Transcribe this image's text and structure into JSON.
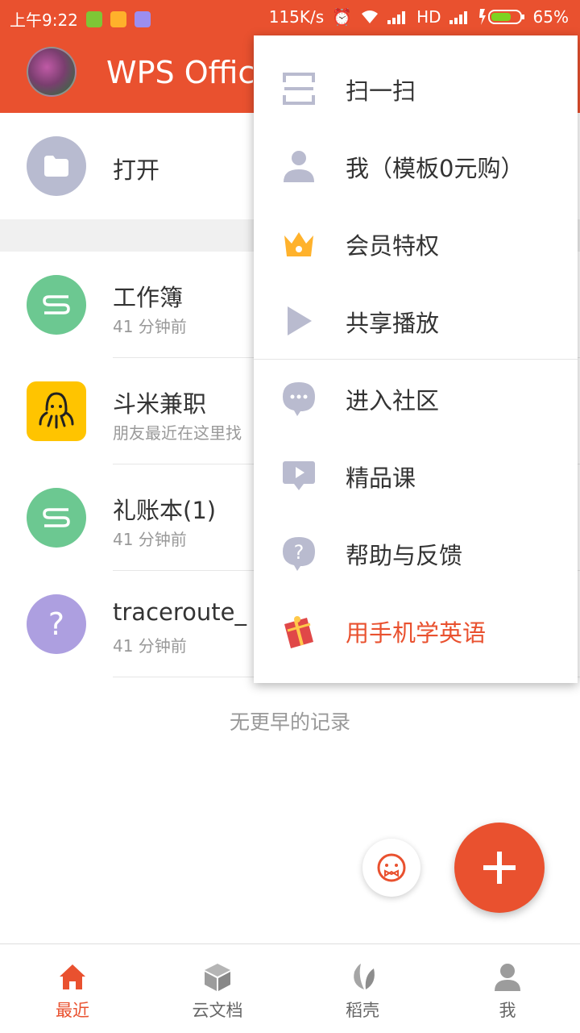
{
  "status_bar": {
    "time": "上午9:22",
    "net_speed": "115K/s",
    "hd": "HD",
    "battery": "65%"
  },
  "app_bar": {
    "title": "WPS Office"
  },
  "list": {
    "open": {
      "label": "打开"
    },
    "items": [
      {
        "title": "工作簿",
        "subtitle": "41 分钟前",
        "icon": "sheet-icon",
        "color": "#6cc891"
      },
      {
        "title": "斗米兼职",
        "subtitle": "朋友最近在这里找",
        "icon": "octopus-icon",
        "color": "#ffc400"
      },
      {
        "title": "礼账本(1)",
        "subtitle": "41 分钟前",
        "icon": "sheet-icon",
        "color": "#6cc891"
      },
      {
        "title": "traceroute_",
        "subtitle": "41 分钟前",
        "icon": "question-icon",
        "color": "#ad9fe0"
      }
    ],
    "no_more": "无更早的记录"
  },
  "menu": {
    "items": [
      {
        "label": "扫一扫",
        "icon": "scan-icon"
      },
      {
        "label": "我（模板0元购）",
        "icon": "person-icon"
      },
      {
        "label": "会员特权",
        "icon": "crown-icon"
      },
      {
        "label": "共享播放",
        "icon": "play-icon"
      },
      {
        "label": "进入社区",
        "icon": "chat-icon"
      },
      {
        "label": "精品课",
        "icon": "video-course-icon"
      },
      {
        "label": "帮助与反馈",
        "icon": "help-icon"
      },
      {
        "label": "用手机学英语",
        "icon": "gift-icon"
      }
    ]
  },
  "bottom_nav": {
    "items": [
      {
        "label": "最近",
        "icon": "home-icon",
        "active": true
      },
      {
        "label": "云文档",
        "icon": "cube-icon"
      },
      {
        "label": "稻壳",
        "icon": "leaf-icon"
      },
      {
        "label": "我",
        "icon": "person-icon"
      }
    ]
  },
  "colors": {
    "brand": "#e9512f",
    "menu_icon": "#b9bbcf"
  }
}
